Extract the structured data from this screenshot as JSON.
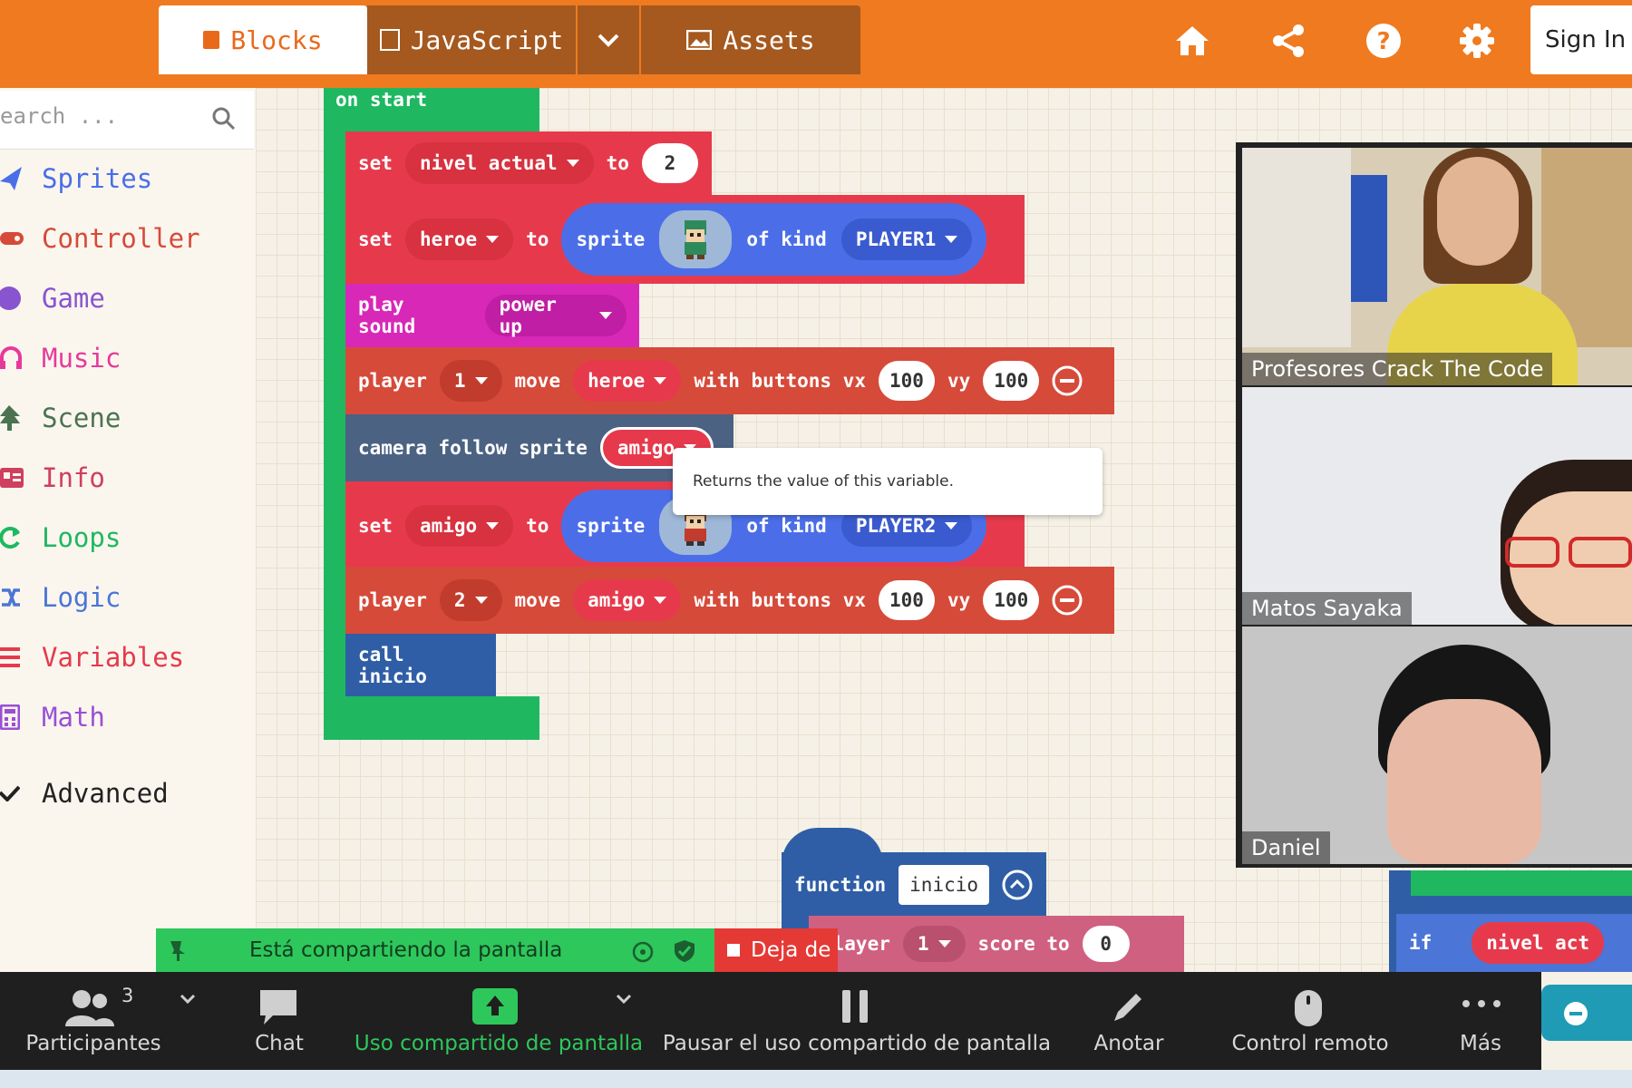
{
  "header": {
    "tabs": [
      {
        "label": "Blocks",
        "icon": "puzzle-icon"
      },
      {
        "label": "JavaScript",
        "icon": "js-file-icon"
      },
      {
        "label": "Assets",
        "icon": "image-icon"
      }
    ],
    "sign_in": "Sign In",
    "icons": [
      "home-icon",
      "share-icon",
      "help-icon",
      "gear-icon"
    ]
  },
  "toolbox": {
    "search_placeholder": "earch ...",
    "categories": [
      {
        "label": "Sprites",
        "color": "#4b6ee8"
      },
      {
        "label": "Controller",
        "color": "#d64a3a"
      },
      {
        "label": "Game",
        "color": "#8854d0"
      },
      {
        "label": "Music",
        "color": "#e63a9b"
      },
      {
        "label": "Scene",
        "color": "#4b7350"
      },
      {
        "label": "Info",
        "color": "#cf3f5e"
      },
      {
        "label": "Loops",
        "color": "#1fb861"
      },
      {
        "label": "Logic",
        "color": "#4b75d6"
      },
      {
        "label": "Variables",
        "color": "#e53a4c"
      },
      {
        "label": "Math",
        "color": "#9a4fd6"
      },
      {
        "label": "Advanced",
        "color": "#222222"
      }
    ]
  },
  "blocks": {
    "on_start": "on start",
    "set1": {
      "kw": "set",
      "var": "nivel actual",
      "to": "to",
      "value": "2"
    },
    "set2": {
      "kw": "set",
      "var": "heroe",
      "to": "to",
      "sprite": "sprite",
      "of_kind": "of kind",
      "kind": "PLAYER1"
    },
    "play": {
      "kw": "play sound",
      "sound": "power up"
    },
    "move1": {
      "kw": "player",
      "num": "1",
      "move": "move",
      "sprite": "heroe",
      "with": "with buttons vx",
      "vx": "100",
      "vy_label": "vy",
      "vy": "100"
    },
    "camera": {
      "kw": "camera follow sprite",
      "sprite": "amigo"
    },
    "set3": {
      "kw": "set",
      "var": "amigo",
      "to": "to",
      "sprite": "sprite",
      "of_kind": "of kind",
      "kind": "PLAYER2"
    },
    "move2": {
      "kw": "player",
      "num": "2",
      "move": "move",
      "sprite": "amigo",
      "with": "with buttons vx",
      "vx": "100",
      "vy_label": "vy",
      "vy": "100"
    },
    "call": "call inicio",
    "function": {
      "kw": "function",
      "name": "inicio"
    },
    "score": {
      "kw": "player",
      "num": "1",
      "score": "score to",
      "value": "0"
    },
    "if_block": {
      "kw": "if",
      "var": "nivel act"
    },
    "tooltip": "Returns the value of this variable."
  },
  "video": {
    "participants": [
      {
        "name": "Profesores Crack The Code"
      },
      {
        "name": "Matos Sayaka"
      },
      {
        "name": "Daniel"
      }
    ]
  },
  "share_bar": {
    "message": "Está compartiendo la pantalla",
    "stop": "Deja de"
  },
  "zoom_toolbar": {
    "participants_count": "3",
    "items": [
      {
        "label": "Participantes",
        "icon": "participants-icon"
      },
      {
        "label": "Chat",
        "icon": "chat-icon"
      },
      {
        "label": "Uso compartido de pantalla",
        "icon": "share-screen-icon",
        "color": "#2ec75b"
      },
      {
        "label": "Pausar el uso compartido de pantalla",
        "icon": "pause-icon"
      },
      {
        "label": "Anotar",
        "icon": "pencil-icon"
      },
      {
        "label": "Control remoto",
        "icon": "mouse-icon"
      },
      {
        "label": "Más",
        "icon": "more-icon"
      }
    ]
  }
}
